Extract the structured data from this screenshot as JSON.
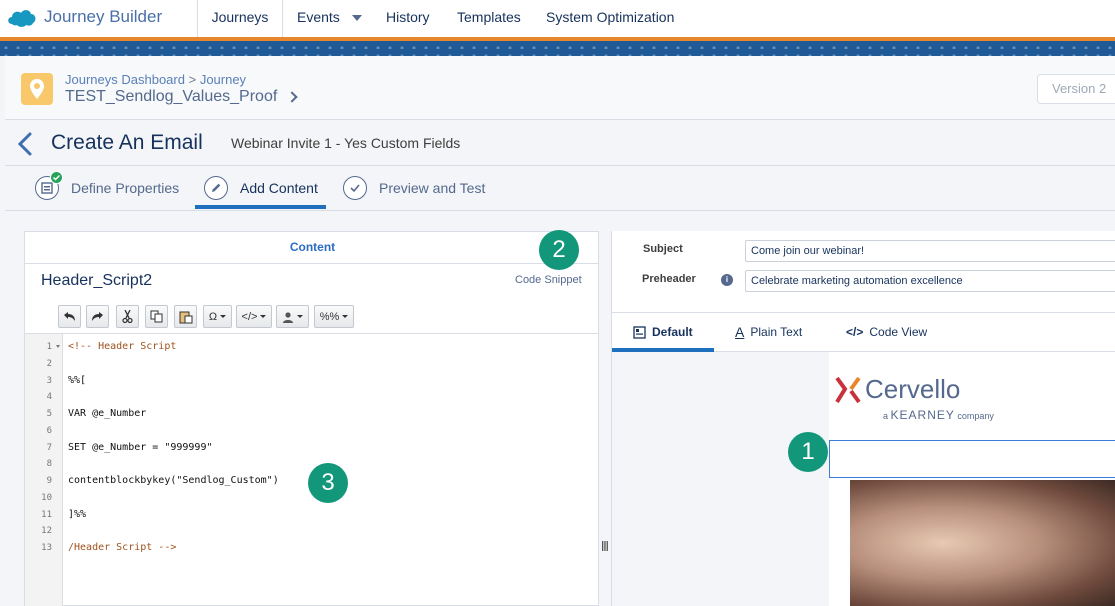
{
  "topnav": {
    "brand": "Journey Builder",
    "tabs": [
      {
        "label": "Journeys",
        "active": true
      },
      {
        "label": "Events",
        "has_dropdown": true
      },
      {
        "label": "History"
      },
      {
        "label": "Templates"
      },
      {
        "label": "System Optimization"
      }
    ]
  },
  "journey": {
    "breadcrumb_parent": "Journeys Dashboard",
    "breadcrumb_sep": ">",
    "breadcrumb_current": "Journey",
    "name": "TEST_Sendlog_Values_Proof",
    "version_label": "Version 2"
  },
  "create_email": {
    "title": "Create An Email",
    "subtitle": "Webinar Invite 1 - Yes Custom Fields"
  },
  "steps": [
    {
      "label": "Define Properties",
      "complete": true
    },
    {
      "label": "Add Content",
      "active": true
    },
    {
      "label": "Preview and Test"
    }
  ],
  "editor": {
    "panel_label": "Content",
    "block_name": "Header_Script2",
    "block_type": "Code Snippet",
    "toolbar": {
      "special_char": "Ω",
      "code": "</>",
      "personalize": "",
      "ampscript": "%%"
    },
    "lines": [
      {
        "n": "1",
        "text": "<!-- Header Script",
        "comment": true
      },
      {
        "n": "2",
        "text": ""
      },
      {
        "n": "3",
        "text": "%%["
      },
      {
        "n": "4",
        "text": ""
      },
      {
        "n": "5",
        "text": "VAR @e_Number"
      },
      {
        "n": "6",
        "text": ""
      },
      {
        "n": "7",
        "text": "SET @e_Number = \"999999\""
      },
      {
        "n": "8",
        "text": ""
      },
      {
        "n": "9",
        "text": "contentblockbykey(\"Sendlog_Custom\")"
      },
      {
        "n": "10",
        "text": ""
      },
      {
        "n": "11",
        "text": "]%%"
      },
      {
        "n": "12",
        "text": ""
      },
      {
        "n": "13",
        "text": "/Header Script -->",
        "comment": true
      }
    ]
  },
  "preview": {
    "subject_label": "Subject",
    "subject_value": "Come join our webinar!",
    "preheader_label": "Preheader",
    "preheader_value": "Celebrate marketing automation excellence",
    "tabs": [
      {
        "label": "Default",
        "active": true
      },
      {
        "label": "Plain Text"
      },
      {
        "label": "Code View"
      }
    ],
    "logo_text": "Cervello",
    "logo_sub_a": "a",
    "logo_sub_brand": "KEARNEY",
    "logo_sub_company": "company"
  },
  "callouts": [
    "1",
    "2",
    "3"
  ],
  "colors": {
    "accent_blue": "#1f6fbf",
    "orange_bar": "#e8862b",
    "callout_green": "#13977a",
    "check_green": "#27a35a"
  }
}
